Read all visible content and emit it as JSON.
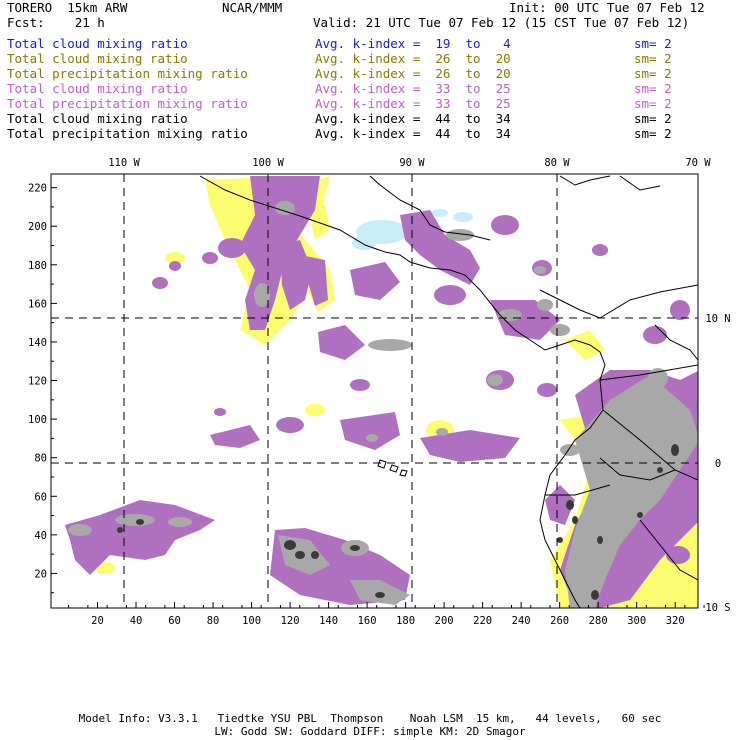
{
  "header": {
    "model": "TORERO  15km ARW",
    "center": "NCAR/MMM",
    "init": "Init: 00 UTC Tue 07 Feb 12",
    "fcst": "Fcst:    21 h",
    "valid": "Valid: 21 UTC Tue 07 Feb 12 (15 CST Tue 07 Feb 12)"
  },
  "legend": [
    {
      "field": "Total cloud mixing ratio",
      "index": "Avg. k-index =  19  to   4",
      "sm": "sm= 2",
      "color": "#1a1acc"
    },
    {
      "field": "Total cloud mixing ratio",
      "index": "Avg. k-index =  26  to  20",
      "sm": "sm= 2",
      "color": "#8a7a00"
    },
    {
      "field": "Total precipitation mixing ratio",
      "index": "Avg. k-index =  26  to  20",
      "sm": "sm= 2",
      "color": "#8a7a00"
    },
    {
      "field": "Total cloud mixing ratio",
      "index": "Avg. k-index =  33  to  25",
      "sm": "sm= 2",
      "color": "#c060c8"
    },
    {
      "field": "Total precipitation mixing ratio",
      "index": "Avg. k-index =  33  to  25",
      "sm": "sm= 2",
      "color": "#c060c8"
    },
    {
      "field": "Total cloud mixing ratio",
      "index": "Avg. k-index =  44  to  34",
      "sm": "sm= 2",
      "color": "#000000"
    },
    {
      "field": "Total precipitation mixing ratio",
      "index": "Avg. k-index =  44  to  34",
      "sm": "sm= 2",
      "color": "#000000"
    }
  ],
  "axes": {
    "lon_labels": [
      "110 W",
      "100 W",
      "90 W",
      "80 W",
      "70 W"
    ],
    "lat_labels": [
      "10 N",
      "0",
      "10 S"
    ],
    "grid_x_ticks": [
      "20",
      "40",
      "60",
      "80",
      "100",
      "120",
      "140",
      "160",
      "180",
      "200",
      "220",
      "240",
      "260",
      "280",
      "300",
      "320"
    ],
    "grid_y_ticks": [
      "20",
      "40",
      "60",
      "80",
      "100",
      "120",
      "140",
      "160",
      "180",
      "200",
      "220"
    ]
  },
  "colors": {
    "light_blue": "#c8ecf8",
    "yellow": "#fcfc70",
    "purple": "#b070c0",
    "gray": "#a8a8a8",
    "dark": "#3a3a3a"
  },
  "footer": {
    "line1": "Model Info: V3.3.1   Tiedtke YSU PBL  Thompson    Noah LSM  15 km,   44 levels,   60 sec",
    "line2": "LW: Godd SW: Goddard DIFF: simple KM: 2D Smagor"
  }
}
